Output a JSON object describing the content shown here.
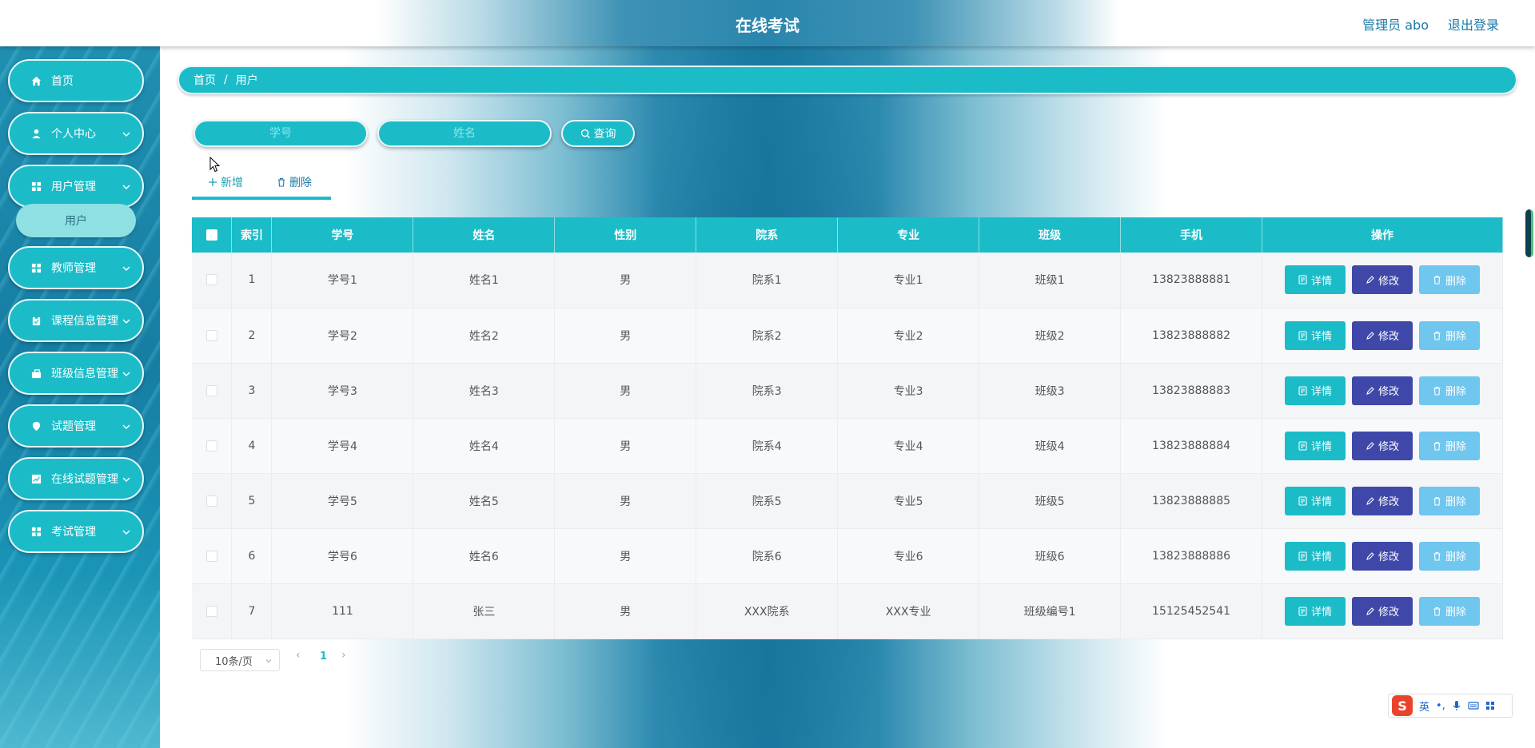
{
  "header": {
    "title": "在线考试",
    "user_label": "管理员 abo",
    "logout_label": "退出登录"
  },
  "sidebar": {
    "items": [
      {
        "label": "首页",
        "icon": "home-icon"
      },
      {
        "label": "个人中心",
        "icon": "user-icon"
      },
      {
        "label": "用户管理",
        "icon": "grid-icon"
      },
      {
        "label": "教师管理",
        "icon": "grid-icon"
      },
      {
        "label": "课程信息管理",
        "icon": "clipboard-icon"
      },
      {
        "label": "班级信息管理",
        "icon": "briefcase-icon"
      },
      {
        "label": "试题管理",
        "icon": "location-icon"
      },
      {
        "label": "在线试题管理",
        "icon": "chart-icon"
      },
      {
        "label": "考试管理",
        "icon": "grid-icon"
      }
    ],
    "submenu": {
      "label": "用户"
    }
  },
  "breadcrumb": {
    "home": "首页",
    "sep": "/",
    "current": "用户"
  },
  "search": {
    "student_id_placeholder": "学号",
    "name_placeholder": "姓名",
    "query_label": "查询"
  },
  "actions": {
    "add_label": "新增",
    "delete_label": "删除"
  },
  "table": {
    "headers": [
      "索引",
      "学号",
      "姓名",
      "性别",
      "院系",
      "专业",
      "班级",
      "手机",
      "操作"
    ],
    "buttons": {
      "detail": "详情",
      "edit": "修改",
      "remove": "删除"
    },
    "rows": [
      {
        "index": "1",
        "student_id": "学号1",
        "name": "姓名1",
        "gender": "男",
        "dept": "院系1",
        "major": "专业1",
        "class": "班级1",
        "phone": "13823888881"
      },
      {
        "index": "2",
        "student_id": "学号2",
        "name": "姓名2",
        "gender": "男",
        "dept": "院系2",
        "major": "专业2",
        "class": "班级2",
        "phone": "13823888882"
      },
      {
        "index": "3",
        "student_id": "学号3",
        "name": "姓名3",
        "gender": "男",
        "dept": "院系3",
        "major": "专业3",
        "class": "班级3",
        "phone": "13823888883"
      },
      {
        "index": "4",
        "student_id": "学号4",
        "name": "姓名4",
        "gender": "男",
        "dept": "院系4",
        "major": "专业4",
        "class": "班级4",
        "phone": "13823888884"
      },
      {
        "index": "5",
        "student_id": "学号5",
        "name": "姓名5",
        "gender": "男",
        "dept": "院系5",
        "major": "专业5",
        "class": "班级5",
        "phone": "13823888885"
      },
      {
        "index": "6",
        "student_id": "学号6",
        "name": "姓名6",
        "gender": "男",
        "dept": "院系6",
        "major": "专业6",
        "class": "班级6",
        "phone": "13823888886"
      },
      {
        "index": "7",
        "student_id": "111",
        "name": "张三",
        "gender": "男",
        "dept": "XXX院系",
        "major": "XXX专业",
        "class": "班级编号1",
        "phone": "15125452541"
      }
    ]
  },
  "pagination": {
    "page_size": "10条/页",
    "current_page": "1",
    "prev": "‹",
    "next": "›"
  },
  "ime": {
    "logo": "S",
    "mode": "英",
    "punct": "•,"
  },
  "colors": {
    "accent": "#1bbcc8",
    "edit_button": "#3f48a8",
    "remove_button": "#6fc6ee",
    "header_link": "#1a7aa8"
  }
}
